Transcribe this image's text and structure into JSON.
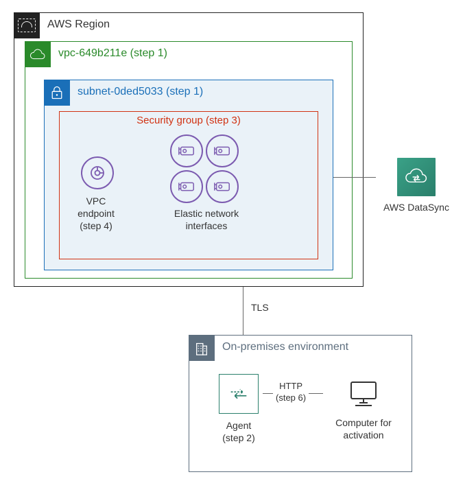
{
  "region": {
    "label": "AWS Region"
  },
  "vpc": {
    "label": "vpc-649b211e (step 1)"
  },
  "subnet": {
    "label": "subnet-0ded5033 (step 1)"
  },
  "security_group": {
    "label": "Security group (step 3)"
  },
  "vpc_endpoint": {
    "label": "VPC\nendpoint\n(step 4)"
  },
  "eni": {
    "label": "Elastic network\ninterfaces"
  },
  "datasync": {
    "label": "AWS DataSync"
  },
  "tls": {
    "label": "TLS"
  },
  "onprem": {
    "label": "On-premises environment"
  },
  "agent": {
    "label": "Agent\n(step 2)"
  },
  "computer": {
    "label": "Computer for\nactivation"
  },
  "http": {
    "label": "HTTP\n(step 6)"
  },
  "colors": {
    "region": "#222222",
    "vpc": "#2a8a2a",
    "subnet": "#1a6fb8",
    "sg": "#d13212",
    "onprem": "#5d6e7e",
    "purple": "#7c5bb0",
    "datasync": "#2f8b74"
  }
}
